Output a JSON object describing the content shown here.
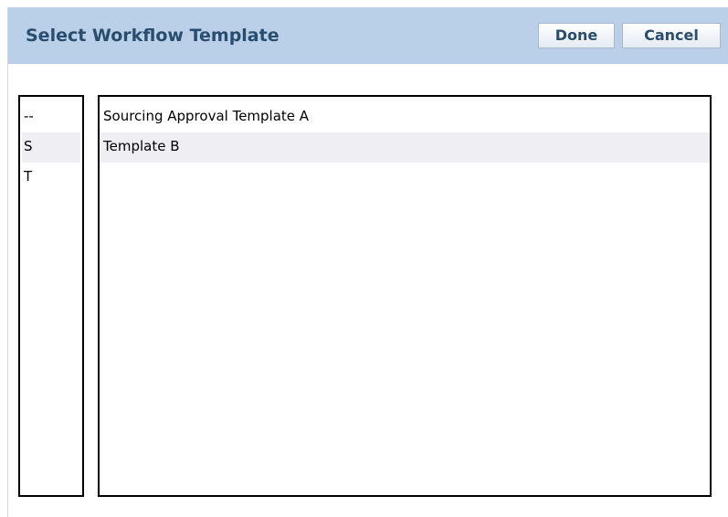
{
  "dialog": {
    "title": "Select Workflow Template",
    "done_label": "Done",
    "cancel_label": "Cancel"
  },
  "index": {
    "items": [
      {
        "label": "--"
      },
      {
        "label": "S"
      },
      {
        "label": "T"
      }
    ]
  },
  "templates": {
    "items": [
      {
        "label": "Sourcing Approval Template A"
      },
      {
        "label": "Template B"
      }
    ]
  },
  "colors": {
    "title_bar": "#b9d0e8",
    "title_text": "#2a4c6e",
    "alt_row": "#eeeef3"
  }
}
